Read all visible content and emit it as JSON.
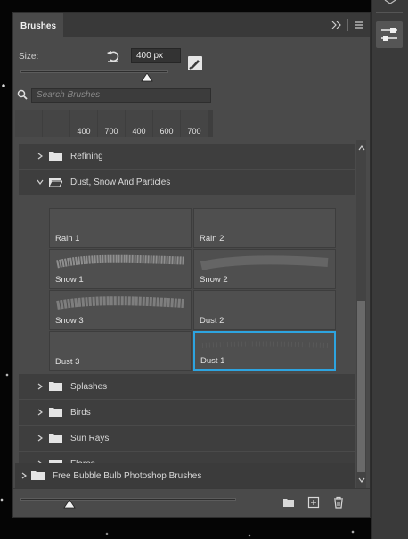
{
  "panel": {
    "tab_label": "Brushes",
    "size_label": "Size:",
    "size_value": "400 px",
    "size_slider_fraction": 0.86,
    "search_placeholder": "Search Brushes"
  },
  "recent_brushes": [
    {
      "label": "",
      "icon": "brush-thumb"
    },
    {
      "label": "",
      "icon": "brush-thumb"
    },
    {
      "label": "400",
      "icon": "brush-thumb"
    },
    {
      "label": "700",
      "icon": "brush-thumb"
    },
    {
      "label": "400",
      "icon": "brush-thumb"
    },
    {
      "label": "600",
      "icon": "brush-thumb"
    },
    {
      "label": "700",
      "icon": "brush-thumb"
    }
  ],
  "groups": [
    {
      "label": "Refining",
      "expanded": false
    },
    {
      "label": "Dust, Snow And Particles",
      "expanded": true
    },
    {
      "label": "Splashes",
      "expanded": false
    },
    {
      "label": "Birds",
      "expanded": false
    },
    {
      "label": "Sun Rays",
      "expanded": false
    },
    {
      "label": "Flares",
      "expanded": false
    }
  ],
  "brushes": [
    {
      "label": "Rain 1",
      "selected": false
    },
    {
      "label": "Rain 2",
      "selected": false
    },
    {
      "label": "Snow 1",
      "selected": false
    },
    {
      "label": "Snow 2",
      "selected": false
    },
    {
      "label": "Snow 3",
      "selected": false
    },
    {
      "label": "Dust 2",
      "selected": false
    },
    {
      "label": "Dust 3",
      "selected": false
    },
    {
      "label": "Dust 1",
      "selected": true
    }
  ],
  "root_group": {
    "label": "Free Bubble Bulb Photoshop Brushes"
  },
  "colors": {
    "panel_bg": "#4a4a4a",
    "selection_accent": "#2da4e0"
  }
}
